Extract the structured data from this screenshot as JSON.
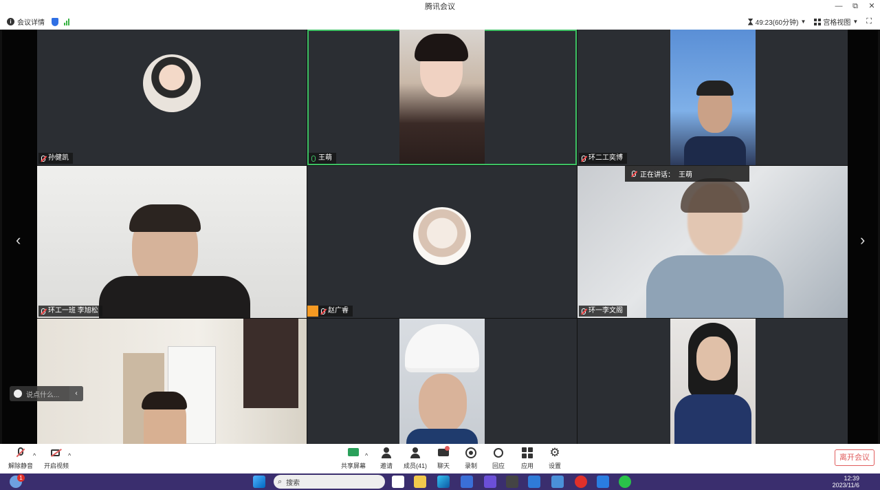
{
  "window": {
    "title": "腾讯会议",
    "controls": [
      "—",
      "⧉",
      "✕"
    ]
  },
  "infobar": {
    "meeting_details": "会议详情",
    "timer": "49:23(60分钟)",
    "layout": "宫格视图"
  },
  "participants": [
    {
      "name": "孙健凯",
      "mic": "muted",
      "display": "avatar"
    },
    {
      "name": "王萌",
      "mic": "on",
      "display": "video",
      "active": true
    },
    {
      "name": "环二工奕博",
      "mic": "muted",
      "display": "video"
    },
    {
      "name": "环工一班 李旭松",
      "mic": "muted",
      "display": "video"
    },
    {
      "name": "赵广睿",
      "mic": "muted",
      "display": "avatar"
    },
    {
      "name": "环一李文阁",
      "mic": "muted",
      "display": "video"
    },
    {
      "name": "",
      "mic": "",
      "display": "video"
    },
    {
      "name": "",
      "mic": "",
      "display": "video"
    },
    {
      "name": "",
      "mic": "",
      "display": "video"
    }
  ],
  "speaking": {
    "label": "正在讲话：",
    "name": "王萌"
  },
  "chat_input": {
    "placeholder": "说点什么..."
  },
  "toolbar": {
    "mute": "解除静音",
    "video": "开启视频",
    "share": "共享屏幕",
    "invite": "邀请",
    "members": "成员(41)",
    "chat": "聊天",
    "record": "录制",
    "reaction": "回应",
    "apps": "应用",
    "settings": "设置",
    "leave": "离开会议"
  },
  "taskbar": {
    "search_placeholder": "搜索",
    "notification_badge": "1",
    "time": "12:39",
    "date": "2023/11/6"
  },
  "colors": {
    "accent_green": "#3ec164",
    "leave_red": "#e05c5c",
    "tile_bg": "#2b2e33",
    "taskbar": "#3a2e6e"
  }
}
